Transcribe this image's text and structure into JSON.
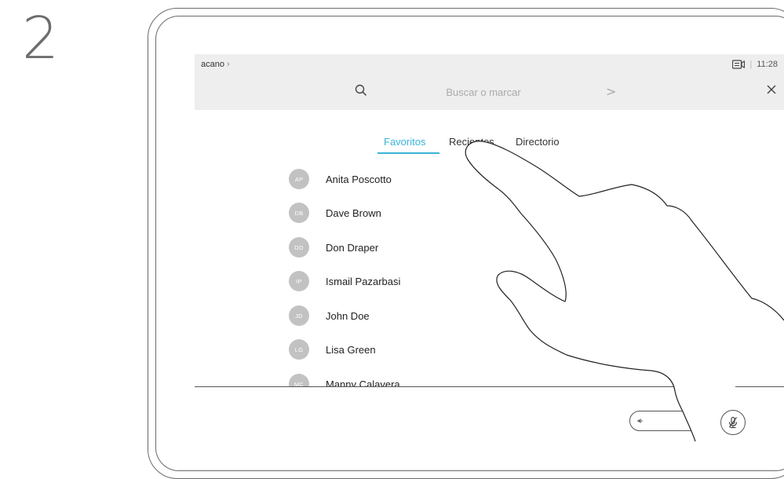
{
  "step": {
    "number": "2"
  },
  "header": {
    "brand": "acano",
    "brand_chevron": "›",
    "time": "11:28",
    "separator": "|",
    "camera_icon": "camera-share-icon"
  },
  "search": {
    "placeholder": "Buscar o marcar",
    "go_arrow": ">",
    "search_icon": "search-icon",
    "close_icon": "close-icon"
  },
  "tabs": [
    {
      "label": "Favoritos",
      "active": true
    },
    {
      "label": "Recientes",
      "active": false
    },
    {
      "label": "Directorio",
      "active": false
    }
  ],
  "contacts": [
    {
      "initials": "AP",
      "name": "Anita Poscotto"
    },
    {
      "initials": "DB",
      "name": "Dave Brown"
    },
    {
      "initials": "DD",
      "name": "Don Draper"
    },
    {
      "initials": "IP",
      "name": "Ismail Pazarbasi"
    },
    {
      "initials": "JD",
      "name": "John Doe"
    },
    {
      "initials": "LG",
      "name": "Lisa Green"
    },
    {
      "initials": "MC",
      "name": "Manny Calavera"
    }
  ],
  "controls": {
    "volume_icon": "volume-icon",
    "mute_icon": "microphone-muted-icon"
  },
  "colors": {
    "accent": "#3ab4d7",
    "avatar": "#c2c2c2",
    "top_bar": "#eeeeee"
  },
  "gesture": "hand-tap-icon"
}
